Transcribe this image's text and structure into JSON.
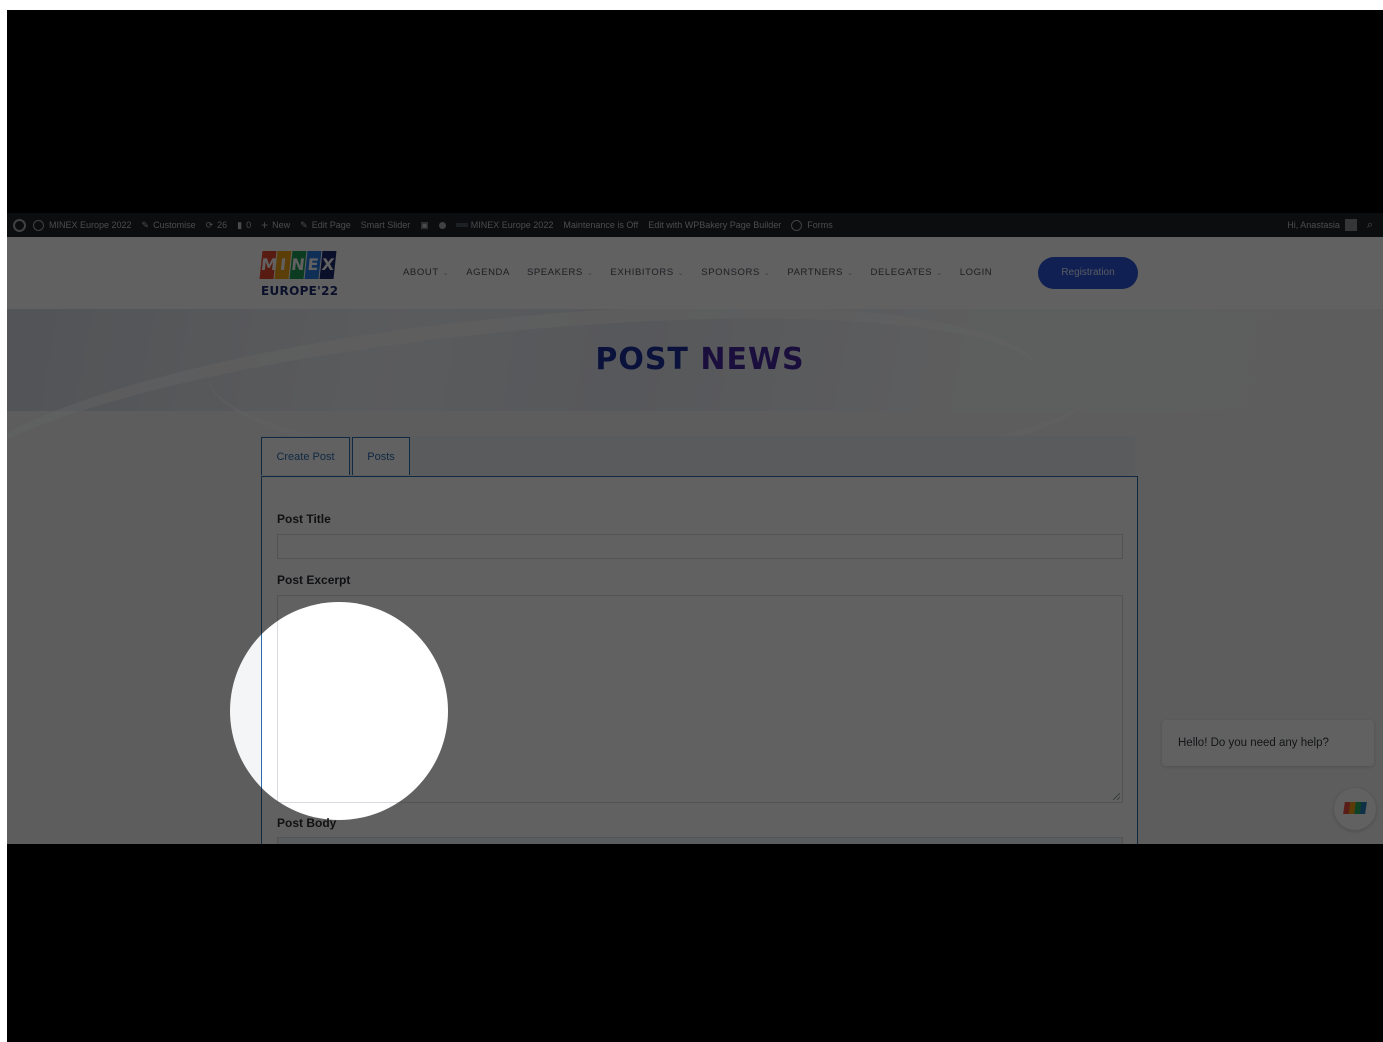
{
  "admin_bar": {
    "site_name": "MINEX Europe 2022",
    "customise": "Customise",
    "updates": "26",
    "comments": "0",
    "new": "New",
    "edit_page": "Edit Page",
    "smart_slider": "Smart Slider",
    "site_name_2": "MINEX Europe 2022",
    "maintenance": "Maintenance is Off",
    "wpbakery": "Edit with WPBakery Page Builder",
    "forms": "Forms",
    "greeting": "Hi, Anastasia"
  },
  "header": {
    "logo_word": "MINEX",
    "logo_letters": [
      "M",
      "I",
      "N",
      "E",
      "X"
    ],
    "logo_colors": [
      "#e8472e",
      "#f2a516",
      "#1f9e5a",
      "#2c7be5",
      "#1d2c6e"
    ],
    "logo_sub": "EUROPE'22",
    "nav": [
      {
        "label": "ABOUT",
        "dropdown": true
      },
      {
        "label": "AGENDA",
        "dropdown": false
      },
      {
        "label": "SPEAKERS",
        "dropdown": true
      },
      {
        "label": "EXHIBITORS",
        "dropdown": true
      },
      {
        "label": "SPONSORS",
        "dropdown": true
      },
      {
        "label": "PARTNERS",
        "dropdown": true
      },
      {
        "label": "DELEGATES",
        "dropdown": true
      },
      {
        "label": "LOGIN",
        "dropdown": false
      }
    ],
    "registration_label": "Registration",
    "accent_color": "#2a56d8"
  },
  "hero": {
    "title_part1": "POST ",
    "title_part2": "NEWS"
  },
  "tabs": {
    "create_post": "Create Post",
    "posts": "Posts"
  },
  "form": {
    "post_title_label": "Post Title",
    "post_title_value": "",
    "post_excerpt_label": "Post Excerpt",
    "post_excerpt_value": "",
    "post_body_label": "Post Body"
  },
  "chat": {
    "message": "Hello! Do you need any help?"
  }
}
